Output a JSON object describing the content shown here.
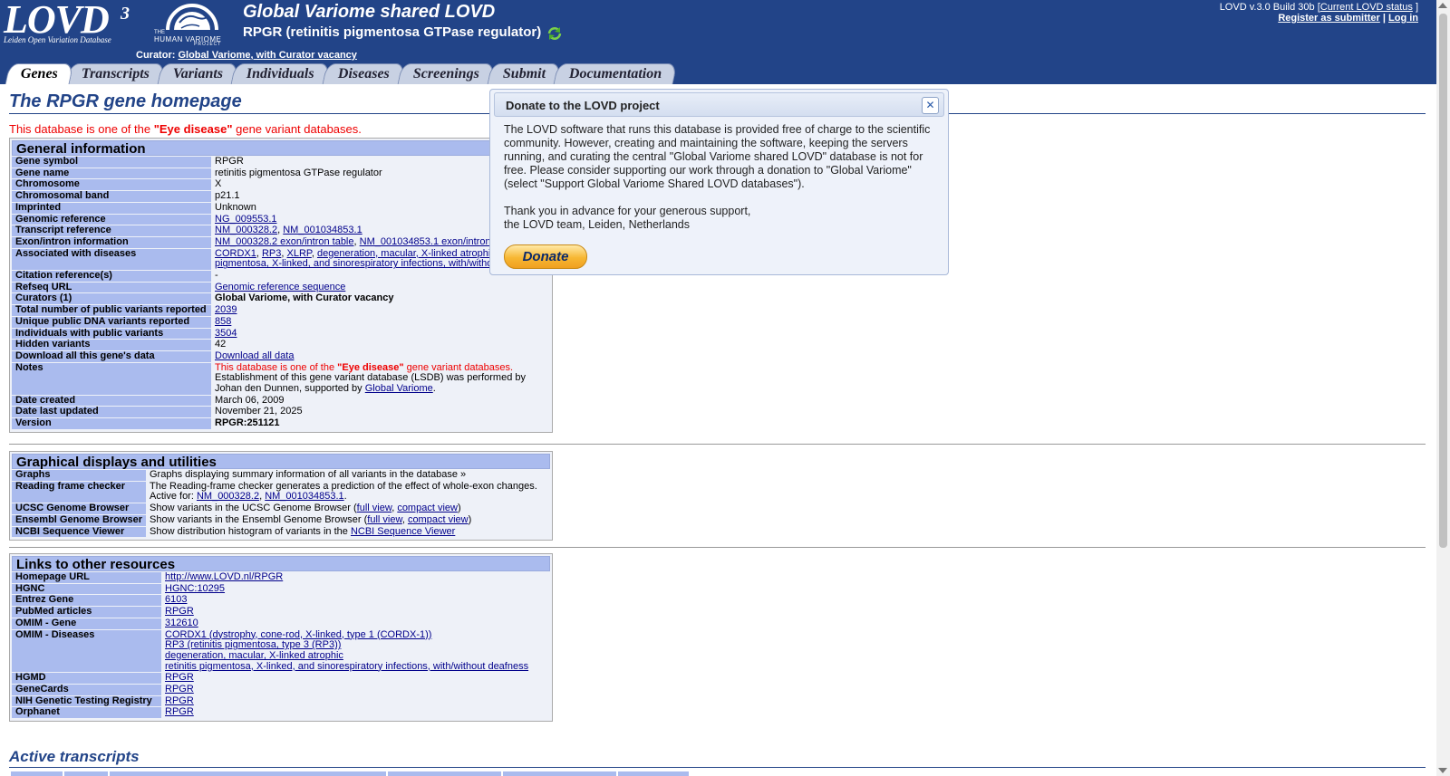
{
  "header": {
    "logo_text": "LOVD",
    "logo_sup": "3",
    "logo_sub": "Leiden Open Variation Database",
    "hvp_the": "THE",
    "hvp_name": "HUMAN VARIOME",
    "hvp_project": "PROJECT",
    "site_title": "Global Variome shared LOVD",
    "gene_title": "RPGR (retinitis pigmentosa GTPase regulator)",
    "curator_label": "Curator:",
    "curator_link": "Global Variome, with Curator vacancy",
    "version_text": "LOVD v.3.0 Build 30b [",
    "version_link": "Current LOVD status",
    "version_end": "]",
    "register_link": "Register as submitter",
    "sep": "|",
    "login_link": "Log in"
  },
  "tabs": [
    "Genes",
    "Transcripts",
    "Variants",
    "Individuals",
    "Diseases",
    "Screenings",
    "Submit",
    "Documentation"
  ],
  "page": {
    "title": "The RPGR gene homepage",
    "note_pre": "This database is one of the ",
    "note_bold": "\"Eye disease\"",
    "note_post": " gene variant databases."
  },
  "general": {
    "title": "General information",
    "gene_symbol_k": "Gene symbol",
    "gene_symbol_v": "RPGR",
    "gene_name_k": "Gene name",
    "gene_name_v": "retinitis pigmentosa GTPase regulator",
    "chromosome_k": "Chromosome",
    "chromosome_v": "X",
    "band_k": "Chromosomal band",
    "band_v": "p21.1",
    "imprinted_k": "Imprinted",
    "imprinted_v": "Unknown",
    "genomic_ref_k": "Genomic reference",
    "genomic_ref_v": "NG_009553.1",
    "transcript_ref_k": "Transcript reference",
    "transcript_ref_1": "NM_000328.2",
    "transcript_ref_2": "NM_001034853.1",
    "exon_k": "Exon/intron information",
    "exon_1": "NM_000328.2 exon/intron table",
    "exon_2": "NM_001034853.1 exon/intron",
    "diseases_k": "Associated with diseases",
    "disease_1": "CORDX1",
    "disease_2": "RP3",
    "disease_3": "XLRP",
    "disease_4": "degeneration, macular, X-linked atrophic",
    "disease_5": "pigmentosa, X-linked, and sinorespiratory infections, with/withou",
    "comma": ", ",
    "citation_k": "Citation reference(s)",
    "citation_v": "-",
    "refseq_k": "Refseq URL",
    "refseq_v": "Genomic reference sequence",
    "curators_k": "Curators (1)",
    "curators_v": "Global Variome, with Curator vacancy",
    "total_k": "Total number of public variants reported",
    "total_v": "2039",
    "unique_k": "Unique public DNA variants reported",
    "unique_v": "858",
    "individuals_k": "Individuals with public variants",
    "individuals_v": "3504",
    "hidden_k": "Hidden variants",
    "hidden_v": "42",
    "download_k": "Download all this gene's data",
    "download_v": "Download all data",
    "notes_k": "Notes",
    "notes_1_pre": "This database is one of the ",
    "notes_1_bold": "\"Eye disease\"",
    "notes_1_post": " gene variant databases.",
    "notes_2": "Establishment of this gene variant database (LSDB) was performed by Johan den Dunnen, supported by ",
    "notes_2_link": "Global Variome",
    "notes_2_end": ".",
    "created_k": "Date created",
    "created_v": "March 06, 2009",
    "updated_k": "Date last updated",
    "updated_v": "November 21, 2025",
    "version_k": "Version",
    "version_v": "RPGR:251121"
  },
  "graphical": {
    "title": "Graphical displays and utilities",
    "graphs_k": "Graphs",
    "graphs_v": "Graphs displaying summary information of all variants in the database »",
    "rfc_k": "Reading frame checker",
    "rfc_v": "The Reading-frame checker generates a prediction of the effect of whole-exon changes.",
    "rfc_active": "Active for: ",
    "rfc_1": "NM_000328.2",
    "rfc_2": "NM_001034853.1",
    "rfc_end": ".",
    "ucsc_k": "UCSC Genome Browser",
    "ucsc_pre": "Show variants in the UCSC Genome Browser (",
    "ensembl_k": "Ensembl Genome Browser",
    "ensembl_pre": "Show variants in the Ensembl Genome Browser (",
    "full_view": "full view",
    "compact_view": "compact view",
    "close_paren": ")",
    "ncbi_k": "NCBI Sequence Viewer",
    "ncbi_pre": "Show distribution histogram of variants in the ",
    "ncbi_link": "NCBI Sequence Viewer"
  },
  "links": {
    "title": "Links to other resources",
    "homepage_k": "Homepage URL",
    "homepage_v": "http://www.LOVD.nl/RPGR",
    "hgnc_k": "HGNC",
    "hgnc_v": "HGNC:10295",
    "entrez_k": "Entrez Gene",
    "entrez_v": "6103",
    "pubmed_k": "PubMed articles",
    "pubmed_v": "RPGR",
    "omim_gene_k": "OMIM - Gene",
    "omim_gene_v": "312610",
    "omim_dis_k": "OMIM - Diseases",
    "omim_dis_1": "CORDX1 (dystrophy, cone-rod, X-linked, type 1 (CORDX-1))",
    "omim_dis_2": "RP3 (retinitis pigmentosa, type 3 (RP3))",
    "omim_dis_3": "degeneration, macular, X-linked atrophic",
    "omim_dis_4": "retinitis pigmentosa, X-linked, and sinorespiratory infections, with/without deafness",
    "hgmd_k": "HGMD",
    "hgmd_v": "RPGR",
    "genecards_k": "GeneCards",
    "genecards_v": "RPGR",
    "nih_k": "NIH Genetic Testing Registry",
    "nih_v": "RPGR",
    "orphanet_k": "Orphanet",
    "orphanet_v": "RPGR"
  },
  "transcripts": {
    "title": "Active transcripts"
  },
  "donate": {
    "title": "Donate to the LOVD project",
    "close": "✕",
    "p1": "The LOVD software that runs this database is provided free of charge to the scientific community. However, creating and maintaining the software, keeping the servers running, and curating the central \"Global Variome shared LOVD\" database is not for free. Please consider supporting our work through a donation to \"Global Variome\" (select \"Support Global Variome Shared LOVD databases\").",
    "p2a": "Thank you in advance for your generous support,",
    "p2b": "the LOVD team, Leiden, Netherlands",
    "button": "Donate"
  },
  "colors": {
    "header_bg": "#224488",
    "label_bg": "#aabbee",
    "value_bg": "#eef1f8",
    "note_red": "#ee0000",
    "link": "#00008b"
  }
}
